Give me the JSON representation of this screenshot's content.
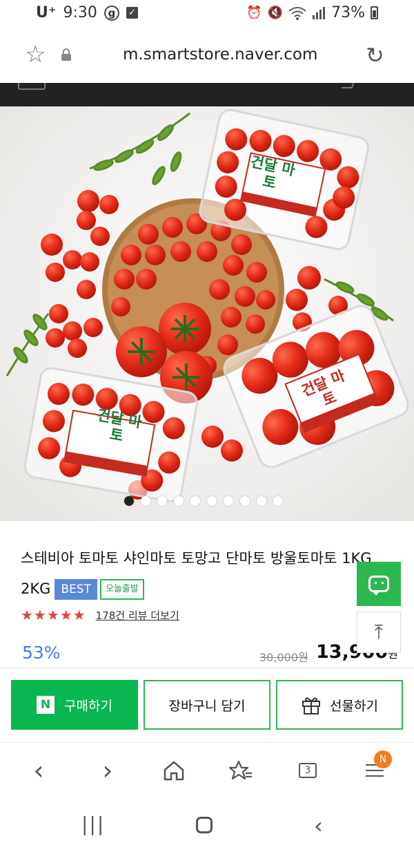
{
  "status_bar": {
    "carrier": "U⁺",
    "time": "9:30",
    "notification_badge": "g",
    "battery": "73%"
  },
  "browser": {
    "url": "m.smartstore.naver.com"
  },
  "gallery": {
    "image_count": 10,
    "active_index": 0,
    "label_text": "건달 마토"
  },
  "product": {
    "title": "스테비아 토마토 샤인마토 토망고 단마토 방울토마토 1KG 2KG",
    "badge_best": "BEST",
    "badge_today": "오늘출발",
    "stars": "★★★★★",
    "rating_stars": 5,
    "review_link": "178건 리뷰 더보기",
    "discount": "53%",
    "original_price": "30,000원",
    "sale_price": "13,900",
    "currency": "원"
  },
  "actions": {
    "buy_logo": "N",
    "buy_label": "구매하기",
    "cart_label": "장바구니 담기",
    "gift_label": "선물하기"
  },
  "browser_nav": {
    "back": "‹",
    "forward": "›",
    "tabs_count": "3",
    "menu_badge": "N"
  },
  "system_nav": {
    "recent": "|||",
    "back": "‹"
  },
  "colors": {
    "naver_green": "#08b74f",
    "best_badge": "#5a88d6",
    "discount_blue": "#4a7bd8",
    "star_red": "#e8413c",
    "notif_orange": "#f47d20"
  }
}
